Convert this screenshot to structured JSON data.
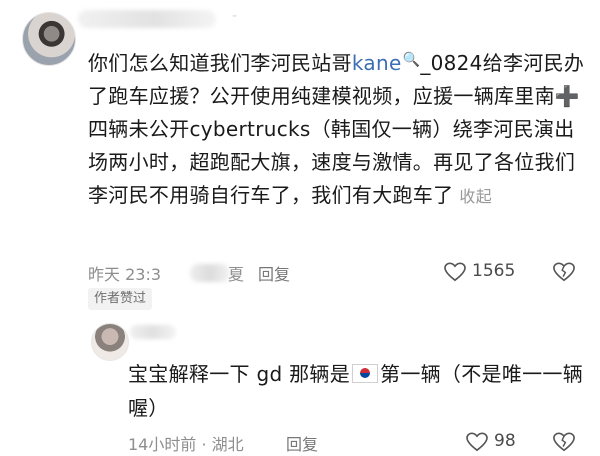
{
  "comment": {
    "name_suffix": "-",
    "text_part1": "你们怎么知道我们李河民站哥",
    "mention": "kane",
    "search_glyph": "🔍",
    "text_part2": "_0824给李河民办了跑车应援？公开使用纯建模视频，应援一辆库里南",
    "plus_glyph": "➕",
    "text_part3": "四辆未公开cybertrucks（韩国仅一辆）绕李河民演出场两小时，超跑配大旗，速度与激情。再见了各位我们李河民不用骑自行车了，我们有大跑车了",
    "collapse_label": "收起",
    "time_visible": "昨天 23:3",
    "time_tail": "夏",
    "reply_label": "回复",
    "like_count": "1565",
    "author_liked_label": "作者赞过"
  },
  "reply": {
    "text_part1": "宝宝解释一下 gd 那辆是",
    "flag_icon": "south-korea-flag",
    "text_part2": "第一辆（不是唯一一辆喔）",
    "time": "14小时前 · 湖北",
    "reply_label": "回复",
    "like_count": "98"
  },
  "colors": {
    "link": "#3b6fb5",
    "meta_text": "#8e8e8e"
  }
}
